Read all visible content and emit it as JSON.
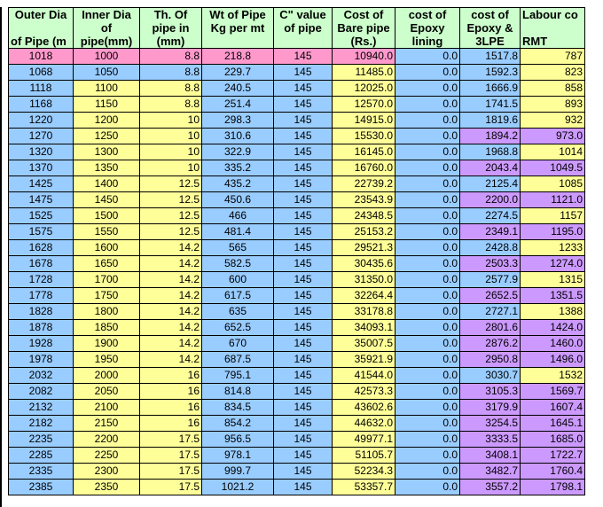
{
  "colors": {
    "header": "#ccffcc",
    "blue": "#99ccff",
    "yellow": "#ffff99",
    "pink": "#ff99cc",
    "purple": "#cc99ff"
  },
  "headers": [
    [
      "Outer Dia",
      "Inner Dia",
      "Th. Of",
      "Wt of Pipe",
      "C\" value",
      "Cost of",
      "cost of",
      "cost of",
      "Labour co"
    ],
    [
      "",
      "of",
      "pipe in",
      "Kg per mt",
      "of pipe",
      "Bare pipe",
      "Epoxy",
      "Epoxy &",
      ""
    ],
    [
      "of Pipe (m",
      "pipe(mm)",
      "(mm)",
      "",
      "",
      "(Rs.)",
      "lining",
      "3LPE",
      "RMT"
    ]
  ],
  "rows": [
    {
      "cells": [
        "1018",
        "1000",
        "8.8",
        "218.8",
        "145",
        "10940.0",
        "0.0",
        "1517.8",
        "787"
      ],
      "colors": [
        "pink",
        "pink",
        "pink",
        "pink",
        "pink",
        "pink",
        "blue",
        "blue",
        "yellow"
      ]
    },
    {
      "cells": [
        "1068",
        "1050",
        "8.8",
        "229.7",
        "145",
        "11485.0",
        "0.0",
        "1592.3",
        "823"
      ],
      "colors": [
        "blue",
        "blue",
        "blue",
        "blue",
        "blue",
        "yellow",
        "blue",
        "blue",
        "yellow"
      ]
    },
    {
      "cells": [
        "1118",
        "1100",
        "8.8",
        "240.5",
        "145",
        "12025.0",
        "0.0",
        "1666.9",
        "858"
      ],
      "colors": [
        "blue",
        "yellow",
        "yellow",
        "blue",
        "blue",
        "yellow",
        "blue",
        "blue",
        "yellow"
      ]
    },
    {
      "cells": [
        "1168",
        "1150",
        "8.8",
        "251.4",
        "145",
        "12570.0",
        "0.0",
        "1741.5",
        "893"
      ],
      "colors": [
        "blue",
        "yellow",
        "yellow",
        "blue",
        "blue",
        "yellow",
        "blue",
        "blue",
        "yellow"
      ]
    },
    {
      "cells": [
        "1220",
        "1200",
        "10",
        "298.3",
        "145",
        "14915.0",
        "0.0",
        "1819.6",
        "932"
      ],
      "colors": [
        "blue",
        "yellow",
        "yellow",
        "blue",
        "blue",
        "yellow",
        "blue",
        "blue",
        "yellow"
      ]
    },
    {
      "cells": [
        "1270",
        "1250",
        "10",
        "310.6",
        "145",
        "15530.0",
        "0.0",
        "1894.2",
        "973.0"
      ],
      "colors": [
        "blue",
        "yellow",
        "yellow",
        "blue",
        "blue",
        "yellow",
        "blue",
        "purple",
        "purple"
      ]
    },
    {
      "cells": [
        "1320",
        "1300",
        "10",
        "322.9",
        "145",
        "16145.0",
        "0.0",
        "1968.8",
        "1014"
      ],
      "colors": [
        "blue",
        "yellow",
        "yellow",
        "blue",
        "blue",
        "yellow",
        "blue",
        "blue",
        "yellow"
      ]
    },
    {
      "cells": [
        "1370",
        "1350",
        "10",
        "335.2",
        "145",
        "16760.0",
        "0.0",
        "2043.4",
        "1049.5"
      ],
      "colors": [
        "blue",
        "yellow",
        "yellow",
        "blue",
        "blue",
        "yellow",
        "blue",
        "purple",
        "purple"
      ]
    },
    {
      "cells": [
        "1425",
        "1400",
        "12.5",
        "435.2",
        "145",
        "22739.2",
        "0.0",
        "2125.4",
        "1085"
      ],
      "colors": [
        "blue",
        "yellow",
        "yellow",
        "blue",
        "blue",
        "yellow",
        "blue",
        "blue",
        "yellow"
      ]
    },
    {
      "cells": [
        "1475",
        "1450",
        "12.5",
        "450.6",
        "145",
        "23543.9",
        "0.0",
        "2200.0",
        "1121.0"
      ],
      "colors": [
        "blue",
        "yellow",
        "yellow",
        "blue",
        "blue",
        "yellow",
        "blue",
        "purple",
        "purple"
      ]
    },
    {
      "cells": [
        "1525",
        "1500",
        "12.5",
        "466",
        "145",
        "24348.5",
        "0.0",
        "2274.5",
        "1157"
      ],
      "colors": [
        "blue",
        "yellow",
        "yellow",
        "blue",
        "blue",
        "yellow",
        "blue",
        "blue",
        "yellow"
      ]
    },
    {
      "cells": [
        "1575",
        "1550",
        "12.5",
        "481.4",
        "145",
        "25153.2",
        "0.0",
        "2349.1",
        "1195.0"
      ],
      "colors": [
        "blue",
        "yellow",
        "yellow",
        "blue",
        "blue",
        "yellow",
        "blue",
        "purple",
        "purple"
      ]
    },
    {
      "cells": [
        "1628",
        "1600",
        "14.2",
        "565",
        "145",
        "29521.3",
        "0.0",
        "2428.8",
        "1233"
      ],
      "colors": [
        "blue",
        "yellow",
        "yellow",
        "blue",
        "blue",
        "yellow",
        "blue",
        "blue",
        "yellow"
      ]
    },
    {
      "cells": [
        "1678",
        "1650",
        "14.2",
        "582.5",
        "145",
        "30435.6",
        "0.0",
        "2503.3",
        "1274.0"
      ],
      "colors": [
        "blue",
        "yellow",
        "yellow",
        "blue",
        "blue",
        "yellow",
        "blue",
        "purple",
        "purple"
      ]
    },
    {
      "cells": [
        "1728",
        "1700",
        "14.2",
        "600",
        "145",
        "31350.0",
        "0.0",
        "2577.9",
        "1315"
      ],
      "colors": [
        "blue",
        "yellow",
        "yellow",
        "blue",
        "blue",
        "yellow",
        "blue",
        "blue",
        "yellow"
      ]
    },
    {
      "cells": [
        "1778",
        "1750",
        "14.2",
        "617.5",
        "145",
        "32264.4",
        "0.0",
        "2652.5",
        "1351.5"
      ],
      "colors": [
        "blue",
        "yellow",
        "yellow",
        "blue",
        "blue",
        "yellow",
        "blue",
        "purple",
        "purple"
      ]
    },
    {
      "cells": [
        "1828",
        "1800",
        "14.2",
        "635",
        "145",
        "33178.8",
        "0.0",
        "2727.1",
        "1388"
      ],
      "colors": [
        "blue",
        "yellow",
        "yellow",
        "blue",
        "blue",
        "yellow",
        "blue",
        "blue",
        "yellow"
      ]
    },
    {
      "cells": [
        "1878",
        "1850",
        "14.2",
        "652.5",
        "145",
        "34093.1",
        "0.0",
        "2801.6",
        "1424.0"
      ],
      "colors": [
        "blue",
        "yellow",
        "yellow",
        "blue",
        "blue",
        "yellow",
        "blue",
        "purple",
        "purple"
      ]
    },
    {
      "cells": [
        "1928",
        "1900",
        "14.2",
        "670",
        "145",
        "35007.5",
        "0.0",
        "2876.2",
        "1460.0"
      ],
      "colors": [
        "blue",
        "yellow",
        "yellow",
        "blue",
        "blue",
        "yellow",
        "blue",
        "purple",
        "purple"
      ]
    },
    {
      "cells": [
        "1978",
        "1950",
        "14.2",
        "687.5",
        "145",
        "35921.9",
        "0.0",
        "2950.8",
        "1496.0"
      ],
      "colors": [
        "blue",
        "yellow",
        "yellow",
        "blue",
        "blue",
        "yellow",
        "blue",
        "purple",
        "purple"
      ]
    },
    {
      "cells": [
        "2032",
        "2000",
        "16",
        "795.1",
        "145",
        "41544.0",
        "0.0",
        "3030.7",
        "1532"
      ],
      "colors": [
        "blue",
        "yellow",
        "yellow",
        "blue",
        "blue",
        "yellow",
        "blue",
        "blue",
        "yellow"
      ]
    },
    {
      "cells": [
        "2082",
        "2050",
        "16",
        "814.8",
        "145",
        "42573.3",
        "0.0",
        "3105.3",
        "1569.7"
      ],
      "colors": [
        "blue",
        "yellow",
        "yellow",
        "blue",
        "blue",
        "yellow",
        "blue",
        "purple",
        "purple"
      ]
    },
    {
      "cells": [
        "2132",
        "2100",
        "16",
        "834.5",
        "145",
        "43602.6",
        "0.0",
        "3179.9",
        "1607.4"
      ],
      "colors": [
        "blue",
        "yellow",
        "yellow",
        "blue",
        "blue",
        "yellow",
        "blue",
        "purple",
        "purple"
      ]
    },
    {
      "cells": [
        "2182",
        "2150",
        "16",
        "854.2",
        "145",
        "44632.0",
        "0.0",
        "3254.5",
        "1645.1"
      ],
      "colors": [
        "blue",
        "yellow",
        "yellow",
        "blue",
        "blue",
        "yellow",
        "blue",
        "purple",
        "purple"
      ]
    },
    {
      "cells": [
        "2235",
        "2200",
        "17.5",
        "956.5",
        "145",
        "49977.1",
        "0.0",
        "3333.5",
        "1685.0"
      ],
      "colors": [
        "blue",
        "yellow",
        "yellow",
        "blue",
        "blue",
        "yellow",
        "blue",
        "purple",
        "purple"
      ]
    },
    {
      "cells": [
        "2285",
        "2250",
        "17.5",
        "978.1",
        "145",
        "51105.7",
        "0.0",
        "3408.1",
        "1722.7"
      ],
      "colors": [
        "blue",
        "yellow",
        "yellow",
        "blue",
        "blue",
        "yellow",
        "blue",
        "purple",
        "purple"
      ]
    },
    {
      "cells": [
        "2335",
        "2300",
        "17.5",
        "999.7",
        "145",
        "52234.3",
        "0.0",
        "3482.7",
        "1760.4"
      ],
      "colors": [
        "blue",
        "yellow",
        "yellow",
        "blue",
        "blue",
        "yellow",
        "blue",
        "purple",
        "purple"
      ]
    },
    {
      "cells": [
        "2385",
        "2350",
        "17.5",
        "1021.2",
        "145",
        "53357.7",
        "0.0",
        "3557.2",
        "1798.1"
      ],
      "colors": [
        "blue",
        "yellow",
        "yellow",
        "blue",
        "blue",
        "yellow",
        "blue",
        "purple",
        "purple"
      ]
    }
  ]
}
